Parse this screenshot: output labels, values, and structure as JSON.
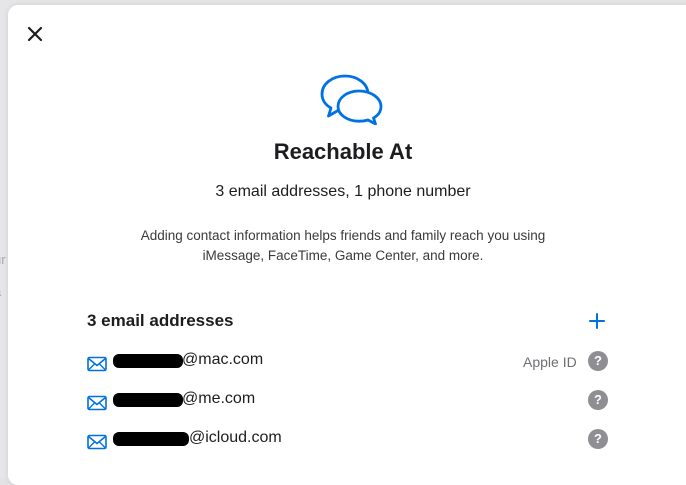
{
  "backdrop": {
    "fragments": [
      "ur",
      "a",
      "s"
    ]
  },
  "dialog": {
    "close_icon": "close-icon",
    "hero_icon": "chat-bubbles-icon",
    "title": "Reachable At",
    "subtitle": "3 email addresses, 1 phone number",
    "description_line1": "Adding contact information helps friends and family reach you using",
    "description_line2": "iMessage, FaceTime, Game Center, and more.",
    "accent_color": "#0071e3"
  },
  "emails": {
    "section_title": "3 email addresses",
    "add_icon": "plus-icon",
    "items": [
      {
        "domain_suffix": "@mac.com",
        "badge": "Apple ID",
        "redacted": true
      },
      {
        "domain_suffix": "@me.com",
        "badge": "",
        "redacted": true
      },
      {
        "domain_suffix": "@icloud.com",
        "badge": "",
        "redacted": true
      }
    ],
    "help_glyph": "?"
  }
}
